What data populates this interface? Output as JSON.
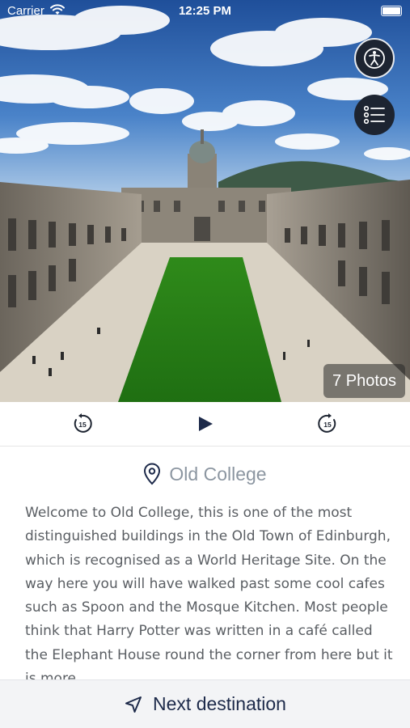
{
  "status_bar": {
    "carrier": "Carrier",
    "time": "12:25 PM",
    "wifi_icon": "wifi-icon",
    "battery_icon": "battery-icon"
  },
  "hero": {
    "image_subject": "old-college-quadrangle-photo",
    "photo_count_label": "7 Photos"
  },
  "floating_buttons": {
    "accessibility_icon": "accessibility-walking-icon",
    "list_icon": "list-icon"
  },
  "audio_controls": {
    "rewind_label": "15",
    "forward_label": "15",
    "play_icon": "play-icon"
  },
  "location": {
    "title": "Old College",
    "icon": "map-pin-icon"
  },
  "description": "Welcome to Old College, this is one of the most distinguished buildings in the Old Town of Edinburgh, which is recognised as a World Heritage Site. On the way here you will have walked past some cool cafes such as Spoon and the Mosque Kitchen. Most people think that Harry Potter was written in a café called the Elephant House round the corner from here but it is more",
  "bottom_bar": {
    "next_label": "Next destination",
    "icon": "navigation-arrow-icon"
  },
  "colors": {
    "accent_dark": "#1d2431",
    "navy_text": "#1d2a4a",
    "muted_title": "#8c96a1",
    "body_text": "#5a5e63"
  }
}
